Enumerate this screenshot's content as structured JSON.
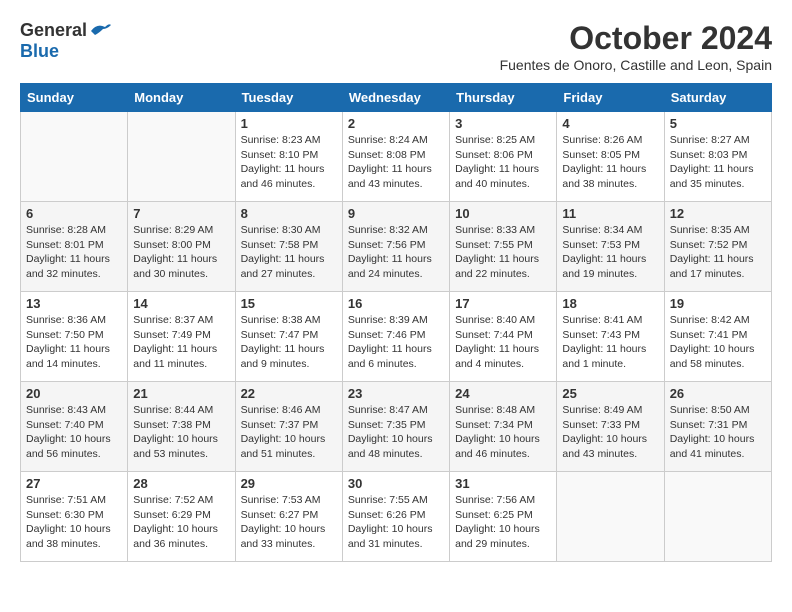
{
  "header": {
    "logo_general": "General",
    "logo_blue": "Blue",
    "title": "October 2024",
    "subtitle": "Fuentes de Onoro, Castille and Leon, Spain"
  },
  "weekdays": [
    "Sunday",
    "Monday",
    "Tuesday",
    "Wednesday",
    "Thursday",
    "Friday",
    "Saturday"
  ],
  "weeks": [
    [
      {
        "day": "",
        "empty": true
      },
      {
        "day": "",
        "empty": true
      },
      {
        "day": "1",
        "sunrise": "Sunrise: 8:23 AM",
        "sunset": "Sunset: 8:10 PM",
        "daylight": "Daylight: 11 hours and 46 minutes."
      },
      {
        "day": "2",
        "sunrise": "Sunrise: 8:24 AM",
        "sunset": "Sunset: 8:08 PM",
        "daylight": "Daylight: 11 hours and 43 minutes."
      },
      {
        "day": "3",
        "sunrise": "Sunrise: 8:25 AM",
        "sunset": "Sunset: 8:06 PM",
        "daylight": "Daylight: 11 hours and 40 minutes."
      },
      {
        "day": "4",
        "sunrise": "Sunrise: 8:26 AM",
        "sunset": "Sunset: 8:05 PM",
        "daylight": "Daylight: 11 hours and 38 minutes."
      },
      {
        "day": "5",
        "sunrise": "Sunrise: 8:27 AM",
        "sunset": "Sunset: 8:03 PM",
        "daylight": "Daylight: 11 hours and 35 minutes."
      }
    ],
    [
      {
        "day": "6",
        "sunrise": "Sunrise: 8:28 AM",
        "sunset": "Sunset: 8:01 PM",
        "daylight": "Daylight: 11 hours and 32 minutes."
      },
      {
        "day": "7",
        "sunrise": "Sunrise: 8:29 AM",
        "sunset": "Sunset: 8:00 PM",
        "daylight": "Daylight: 11 hours and 30 minutes."
      },
      {
        "day": "8",
        "sunrise": "Sunrise: 8:30 AM",
        "sunset": "Sunset: 7:58 PM",
        "daylight": "Daylight: 11 hours and 27 minutes."
      },
      {
        "day": "9",
        "sunrise": "Sunrise: 8:32 AM",
        "sunset": "Sunset: 7:56 PM",
        "daylight": "Daylight: 11 hours and 24 minutes."
      },
      {
        "day": "10",
        "sunrise": "Sunrise: 8:33 AM",
        "sunset": "Sunset: 7:55 PM",
        "daylight": "Daylight: 11 hours and 22 minutes."
      },
      {
        "day": "11",
        "sunrise": "Sunrise: 8:34 AM",
        "sunset": "Sunset: 7:53 PM",
        "daylight": "Daylight: 11 hours and 19 minutes."
      },
      {
        "day": "12",
        "sunrise": "Sunrise: 8:35 AM",
        "sunset": "Sunset: 7:52 PM",
        "daylight": "Daylight: 11 hours and 17 minutes."
      }
    ],
    [
      {
        "day": "13",
        "sunrise": "Sunrise: 8:36 AM",
        "sunset": "Sunset: 7:50 PM",
        "daylight": "Daylight: 11 hours and 14 minutes."
      },
      {
        "day": "14",
        "sunrise": "Sunrise: 8:37 AM",
        "sunset": "Sunset: 7:49 PM",
        "daylight": "Daylight: 11 hours and 11 minutes."
      },
      {
        "day": "15",
        "sunrise": "Sunrise: 8:38 AM",
        "sunset": "Sunset: 7:47 PM",
        "daylight": "Daylight: 11 hours and 9 minutes."
      },
      {
        "day": "16",
        "sunrise": "Sunrise: 8:39 AM",
        "sunset": "Sunset: 7:46 PM",
        "daylight": "Daylight: 11 hours and 6 minutes."
      },
      {
        "day": "17",
        "sunrise": "Sunrise: 8:40 AM",
        "sunset": "Sunset: 7:44 PM",
        "daylight": "Daylight: 11 hours and 4 minutes."
      },
      {
        "day": "18",
        "sunrise": "Sunrise: 8:41 AM",
        "sunset": "Sunset: 7:43 PM",
        "daylight": "Daylight: 11 hours and 1 minute."
      },
      {
        "day": "19",
        "sunrise": "Sunrise: 8:42 AM",
        "sunset": "Sunset: 7:41 PM",
        "daylight": "Daylight: 10 hours and 58 minutes."
      }
    ],
    [
      {
        "day": "20",
        "sunrise": "Sunrise: 8:43 AM",
        "sunset": "Sunset: 7:40 PM",
        "daylight": "Daylight: 10 hours and 56 minutes."
      },
      {
        "day": "21",
        "sunrise": "Sunrise: 8:44 AM",
        "sunset": "Sunset: 7:38 PM",
        "daylight": "Daylight: 10 hours and 53 minutes."
      },
      {
        "day": "22",
        "sunrise": "Sunrise: 8:46 AM",
        "sunset": "Sunset: 7:37 PM",
        "daylight": "Daylight: 10 hours and 51 minutes."
      },
      {
        "day": "23",
        "sunrise": "Sunrise: 8:47 AM",
        "sunset": "Sunset: 7:35 PM",
        "daylight": "Daylight: 10 hours and 48 minutes."
      },
      {
        "day": "24",
        "sunrise": "Sunrise: 8:48 AM",
        "sunset": "Sunset: 7:34 PM",
        "daylight": "Daylight: 10 hours and 46 minutes."
      },
      {
        "day": "25",
        "sunrise": "Sunrise: 8:49 AM",
        "sunset": "Sunset: 7:33 PM",
        "daylight": "Daylight: 10 hours and 43 minutes."
      },
      {
        "day": "26",
        "sunrise": "Sunrise: 8:50 AM",
        "sunset": "Sunset: 7:31 PM",
        "daylight": "Daylight: 10 hours and 41 minutes."
      }
    ],
    [
      {
        "day": "27",
        "sunrise": "Sunrise: 7:51 AM",
        "sunset": "Sunset: 6:30 PM",
        "daylight": "Daylight: 10 hours and 38 minutes."
      },
      {
        "day": "28",
        "sunrise": "Sunrise: 7:52 AM",
        "sunset": "Sunset: 6:29 PM",
        "daylight": "Daylight: 10 hours and 36 minutes."
      },
      {
        "day": "29",
        "sunrise": "Sunrise: 7:53 AM",
        "sunset": "Sunset: 6:27 PM",
        "daylight": "Daylight: 10 hours and 33 minutes."
      },
      {
        "day": "30",
        "sunrise": "Sunrise: 7:55 AM",
        "sunset": "Sunset: 6:26 PM",
        "daylight": "Daylight: 10 hours and 31 minutes."
      },
      {
        "day": "31",
        "sunrise": "Sunrise: 7:56 AM",
        "sunset": "Sunset: 6:25 PM",
        "daylight": "Daylight: 10 hours and 29 minutes."
      },
      {
        "day": "",
        "empty": true
      },
      {
        "day": "",
        "empty": true
      }
    ]
  ]
}
